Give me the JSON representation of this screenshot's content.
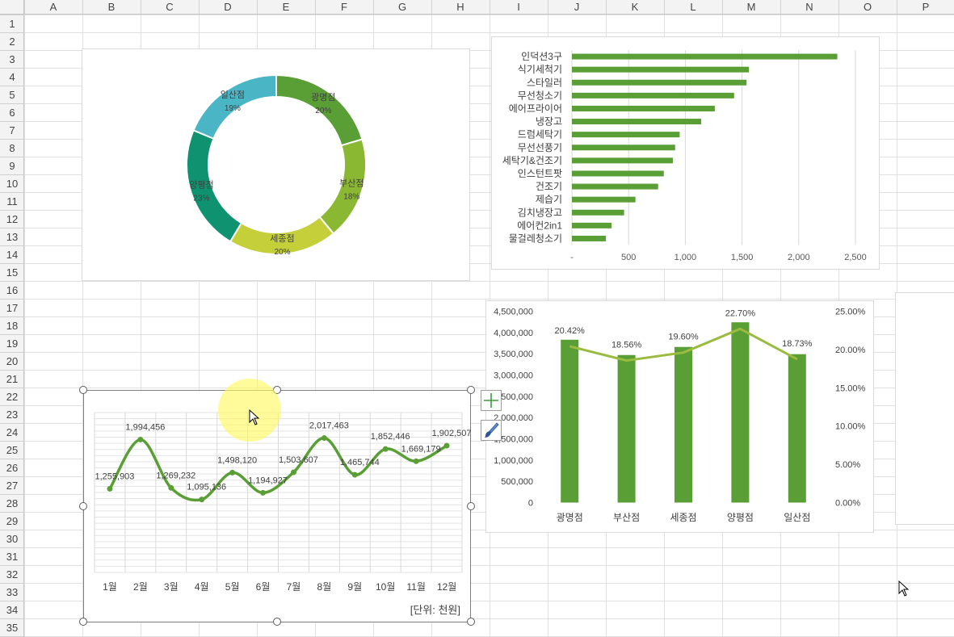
{
  "sheet": {
    "columns": [
      "A",
      "B",
      "C",
      "D",
      "E",
      "F",
      "G",
      "H",
      "I",
      "J",
      "K",
      "L",
      "M",
      "N",
      "O",
      "P"
    ],
    "rows": [
      "1",
      "2",
      "3",
      "4",
      "5",
      "6",
      "7",
      "8",
      "9",
      "10",
      "11",
      "12",
      "13",
      "14",
      "15",
      "16",
      "17",
      "18",
      "19",
      "20",
      "21",
      "22",
      "23",
      "24",
      "25",
      "26",
      "27",
      "28",
      "29",
      "30",
      "31",
      "32",
      "33",
      "34",
      "35"
    ]
  },
  "charts": {
    "donut": {
      "chart_data": {
        "type": "pie",
        "style": "doughnut",
        "categories": [
          "광명점",
          "부산점",
          "세종점",
          "양평점",
          "일산점"
        ],
        "percent_labels": [
          "20%",
          "18%",
          "20%",
          "23%",
          "19%"
        ],
        "values": [
          20.42,
          18.56,
          19.6,
          22.7,
          18.73
        ],
        "colors": [
          "#5a9e36",
          "#8ab833",
          "#c4cf3a",
          "#0e9270",
          "#4ab5c4"
        ]
      }
    },
    "hbar": {
      "chart_data": {
        "type": "bar",
        "orientation": "horizontal",
        "categories": [
          "인덕션3구",
          "식기세척기",
          "스타일러",
          "무선청소기",
          "에어프라이어",
          "냉장고",
          "드럼세탁기",
          "무선선풍기",
          "세탁기&건조기",
          "인스턴트팟",
          "건조기",
          "제습기",
          "김치냉장고",
          "에어컨2in1",
          "물걸레청소기"
        ],
        "values": [
          2340,
          1560,
          1540,
          1430,
          1260,
          1140,
          950,
          910,
          890,
          810,
          760,
          560,
          460,
          350,
          300
        ],
        "xlim": [
          0,
          2500
        ],
        "x_ticks": [
          "-",
          "500",
          "1,000",
          "1,500",
          "2,000",
          "2,500"
        ],
        "x_tick_values": [
          0,
          500,
          1000,
          1500,
          2000,
          2500
        ],
        "grid": true,
        "color": "#5a9e36"
      }
    },
    "combo": {
      "chart_data": {
        "type": "bar",
        "categories": [
          "광명점",
          "부산점",
          "세종점",
          "양평점",
          "일산점"
        ],
        "bar_values": [
          3830000,
          3470000,
          3660000,
          4240000,
          3490000
        ],
        "line_values": [
          20.42,
          18.56,
          19.6,
          22.7,
          18.73
        ],
        "line_labels": [
          "20.42%",
          "18.56%",
          "19.60%",
          "22.70%",
          "18.73%"
        ],
        "ylim": [
          0,
          4500000
        ],
        "y_ticks": [
          "0",
          "500,000",
          "1,000,000",
          "1,500,000",
          "2,000,000",
          "2,500,000",
          "3,000,000",
          "3,500,000",
          "4,000,000",
          "4,500,000"
        ],
        "y2lim": [
          0,
          25
        ],
        "y2_ticks": [
          "0.00%",
          "5.00%",
          "10.00%",
          "15.00%",
          "20.00%",
          "25.00%"
        ],
        "bar_color": "#5a9e36",
        "line_color": "#9bbb3f"
      }
    },
    "line": {
      "chart_data": {
        "type": "line",
        "smooth": true,
        "categories": [
          "1월",
          "2월",
          "3월",
          "4월",
          "5월",
          "6월",
          "7월",
          "8월",
          "9월",
          "10월",
          "11월",
          "12월"
        ],
        "values": [
          1255903,
          1994456,
          1269232,
          1095136,
          1498120,
          1194927,
          1503607,
          2017463,
          1465744,
          1852446,
          1669179,
          1902507
        ],
        "labels": [
          "1,255,903",
          "1,994,456",
          "1,269,232",
          "1,095,136",
          "1,498,120",
          "1,194,927",
          "1,503,607",
          "2,017,463",
          "1,465,744",
          "1,852,446",
          "1,669,179",
          "1,902,507"
        ],
        "ylim": [
          0,
          2400000
        ],
        "grid": true,
        "unit_note": "[단위: 천원]",
        "color": "#5a9e36"
      }
    }
  },
  "colors": {
    "header_bg": "#f3f3f3",
    "grid": "#e1e1e1",
    "accent": "#5a9e36"
  },
  "icons": {
    "chart_elements": "plus-icon",
    "chart_styles": "paintbrush-icon",
    "cursor": "arrow-cursor-icon"
  }
}
